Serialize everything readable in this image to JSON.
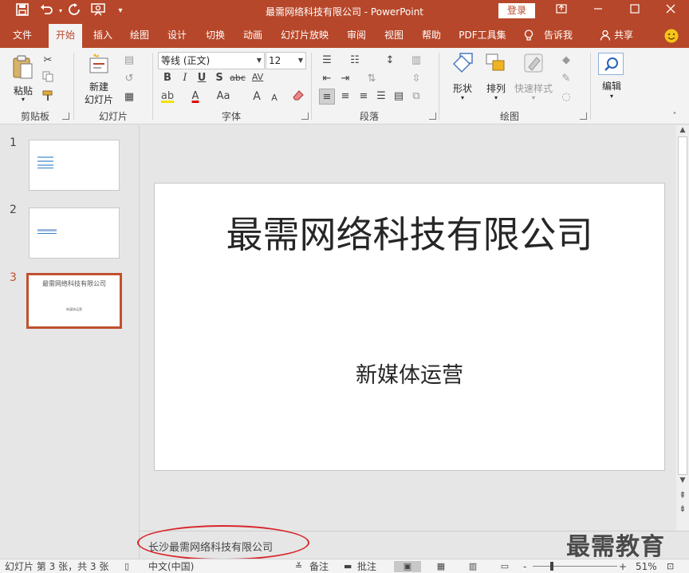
{
  "window": {
    "title": "最需网络科技有限公司  -  PowerPoint",
    "login_label": "登录",
    "ribbon_display_icon": "ribbon-display-options-icon",
    "minimize_icon": "minimize-icon",
    "maximize_icon": "maximize-icon",
    "close_icon": "close-icon"
  },
  "quick_access": {
    "save_icon": "save-icon",
    "undo_icon": "undo-icon",
    "redo_icon": "redo-icon",
    "start_from_beginning_icon": "slideshow-icon",
    "customize_icon": "customize-icon"
  },
  "tabs": [
    "文件",
    "开始",
    "插入",
    "绘图",
    "设计",
    "切换",
    "动画",
    "幻灯片放映",
    "审阅",
    "视图",
    "帮助",
    "PDF工具集",
    "告诉我",
    "共享"
  ],
  "active_tab": "开始",
  "ribbon": {
    "clipboard": {
      "label": "剪贴板",
      "paste": "粘贴"
    },
    "slides": {
      "label": "幻灯片",
      "new_slide_line1": "新建",
      "new_slide_line2": "幻灯片"
    },
    "font": {
      "label": "字体",
      "font_name": "等线 (正文)",
      "font_size": "12",
      "bold": "B",
      "italic": "I",
      "underline": "U",
      "shadow": "S",
      "strike": "abc",
      "spacing": "AV",
      "case": "Aa",
      "grow": "A",
      "shrink": "A",
      "font_color_letter": "A"
    },
    "paragraph": {
      "label": "段落"
    },
    "drawing": {
      "label": "绘图",
      "shapes": "形状",
      "arrange": "排列",
      "quick_styles": "快速样式"
    },
    "editing": {
      "label": "编辑"
    }
  },
  "thumbnails": [
    {
      "number": "1",
      "text": "",
      "sub": ""
    },
    {
      "number": "2",
      "text": "",
      "sub": ""
    },
    {
      "number": "3",
      "text": "最需网络科技有限公司",
      "sub": "新媒体运营"
    }
  ],
  "slide": {
    "title": "最需网络科技有限公司",
    "subtitle": "新媒体运营"
  },
  "notes": {
    "text": "长沙最需网络科技有限公司"
  },
  "watermark": "最需教育",
  "status": {
    "slide_info": "幻灯片 第 3 张，共 3 张",
    "language": "中文(中国)",
    "notes_label": "备注",
    "comments_label": "批注",
    "zoom_minus": "-",
    "zoom_plus": "+",
    "zoom_percent": "51%",
    "zoom_level": 0.51
  },
  "colors": {
    "accent": "#b7472a",
    "selected_border": "#c0502f",
    "annotation_circle": "#d9262c"
  }
}
